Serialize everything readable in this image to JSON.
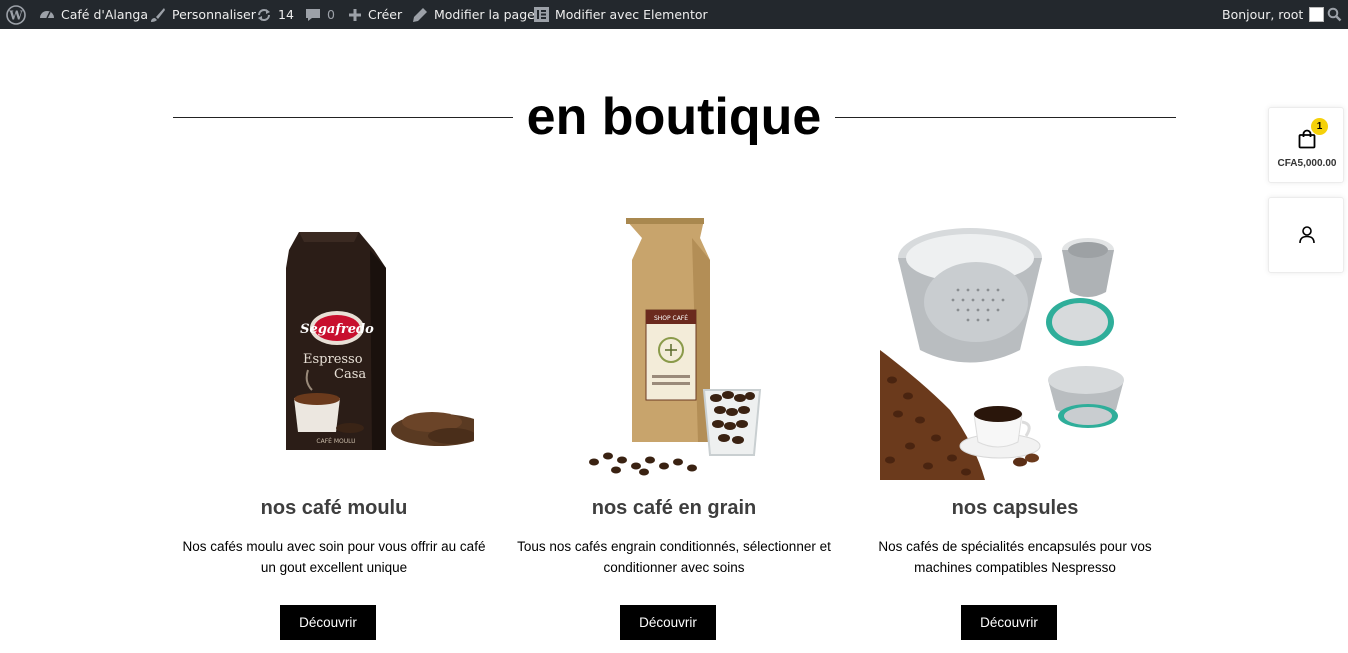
{
  "adminbar": {
    "site_name": "Café d'Alanga",
    "customize": "Personnaliser",
    "updates_count": "14",
    "comments_count": "0",
    "new": "Créer",
    "edit_page": "Modifier la page",
    "edit_elementor": "Modifier avec Elementor",
    "greeting": "Bonjour, root"
  },
  "section": {
    "heading": "en boutique"
  },
  "products": [
    {
      "title": "nos café moulu",
      "desc": "Nos cafés moulu avec soin pour vous offrir au café un gout excellent unique",
      "button": "Découvrir",
      "image_icon": "coffee-bag-ground-image",
      "bag_brand": "Segafredo",
      "bag_line1": "Espresso",
      "bag_line2": "Casa",
      "bag_footer": "CAFÉ MOULU"
    },
    {
      "title": "nos café en grain",
      "desc": "Tous nos cafés engrain conditionnés, sélectionner et conditionner avec soins",
      "button": "Découvrir",
      "image_icon": "coffee-bag-beans-image",
      "bag_label": "SHOP CAFÉ"
    },
    {
      "title": "nos capsules",
      "desc": "Nos cafés de spécialités encapsulés pour vos machines compatibles Nespresso",
      "button": "Découvrir",
      "image_icon": "coffee-capsules-image"
    }
  ],
  "cart": {
    "count": "1",
    "price": "CFA5,000.00"
  },
  "colors": {
    "adminbar": "#23282d",
    "button": "#000000",
    "badge": "#f5d10a",
    "title": "#3e3e3e"
  }
}
